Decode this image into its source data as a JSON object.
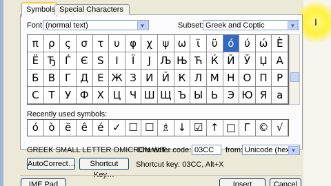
{
  "tabs": [
    "Symbols",
    "Special Characters"
  ],
  "font": {
    "label": "Font:",
    "value": "(normal text)"
  },
  "subset": {
    "label": "Subset:",
    "value": "Greek and Coptic"
  },
  "symbol_grid": [
    [
      "π",
      "ρ",
      "ς",
      "σ",
      "τ",
      "υ",
      "φ",
      "χ",
      "ψ",
      "ω",
      "ϊ",
      "ϋ",
      "ό",
      "ύ",
      "ώ",
      "È"
    ],
    [
      "Ë",
      "Ђ",
      "Ѓ",
      "Є",
      "S",
      "I",
      "Ї",
      "J",
      "Љ",
      "Њ",
      "Ћ",
      "Ќ",
      "Й",
      "Ў",
      "Џ",
      "А"
    ],
    [
      "Б",
      "В",
      "Г",
      "Д",
      "Е",
      "Ж",
      "З",
      "И",
      "Й",
      "К",
      "Л",
      "М",
      "Н",
      "О",
      "П",
      "Р"
    ],
    [
      "С",
      "Т",
      "У",
      "Ф",
      "Х",
      "Ц",
      "Ч",
      "Ш",
      "Щ",
      "Ъ",
      "Ы",
      "Ь",
      "Э",
      "Ю",
      "Я",
      "а"
    ]
  ],
  "selected_symbol": "ό",
  "recent": {
    "label": "Recently used symbols:",
    "symbols": [
      "ό",
      "ò",
      "ë",
      "ê",
      "é",
      "✓",
      "☐",
      "☐",
      "♗",
      "↓",
      "☑",
      "↑",
      "□",
      "Г",
      "©",
      "√"
    ]
  },
  "character_name": "GREEK SMALL LETTER OMICRON WIT…",
  "character_code": {
    "label": "Character code:",
    "value": "03CC"
  },
  "from": {
    "label": "from:",
    "value": "Unicode (hex)"
  },
  "buttons": {
    "autocorrect": "AutoCorrect…",
    "shortcut_key": "Shortcut Key…",
    "ime_pad": "IME Pad",
    "insert": "Insert",
    "cancel": "Cancel"
  },
  "shortcut_text": "Shortcut key: 03CC, Alt+X"
}
